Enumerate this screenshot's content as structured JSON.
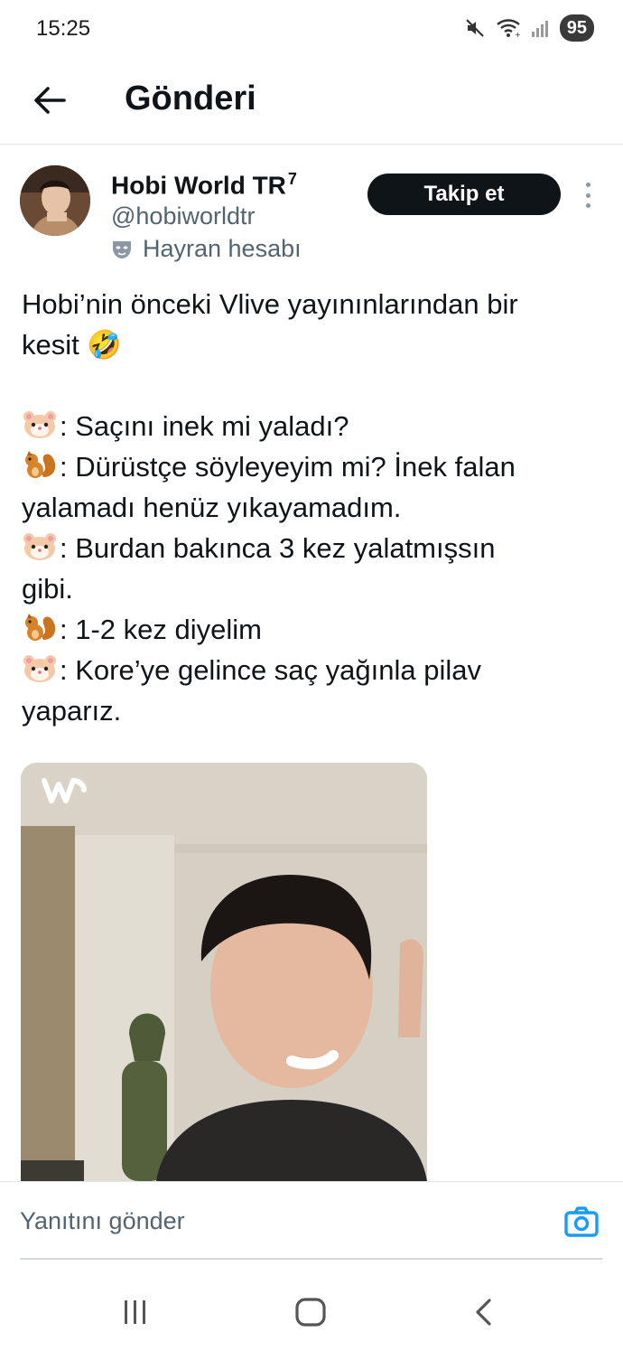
{
  "status_bar": {
    "time": "15:25",
    "battery": "95",
    "icons": [
      "mute-icon",
      "wifi-icon",
      "signal-icon",
      "battery-icon"
    ]
  },
  "app_bar": {
    "title": "Gönderi",
    "back_icon": "back-arrow-icon"
  },
  "post": {
    "author": {
      "name": "Hobi World TR",
      "name_suffix": "7",
      "handle": "@hobiworldtr",
      "badge_text": "Hayran hesabı",
      "badge_icon": "mask-icon"
    },
    "follow_label": "Takip et",
    "text_lines": [
      {
        "emoji": "",
        "text": "Hobi’nin önceki Vlive yayınınlarından bir"
      },
      {
        "emoji": "",
        "text": "kesit 🤣"
      }
    ],
    "dialogue": [
      {
        "speaker_icon": "hamster-icon",
        "text": ": Saçını inek mi yaladı?"
      },
      {
        "speaker_icon": "squirrel-icon",
        "text": ": Dürüstçe söyleyeyim mi? İnek falan"
      },
      {
        "speaker_icon": "",
        "text": "yalamadı henüz yıkayamadım."
      },
      {
        "speaker_icon": "hamster-icon",
        "text": ": Burdan bakınca 3 kez yalatmışsın"
      },
      {
        "speaker_icon": "",
        "text": "gibi."
      },
      {
        "speaker_icon": "squirrel-icon",
        "text": ": 1-2 kez diyelim"
      },
      {
        "speaker_icon": "hamster-icon",
        "text": ": Kore’ye gelince saç yağınla pilav"
      },
      {
        "speaker_icon": "",
        "text": "yaparız."
      }
    ],
    "media": {
      "logo_icon": "weverse-logo-icon"
    }
  },
  "reply": {
    "placeholder": "Yanıtını gönder",
    "camera_icon": "camera-icon"
  },
  "nav_bar": {
    "icons": [
      "recent-apps-icon",
      "home-icon",
      "back-icon"
    ]
  },
  "colors": {
    "accent": "#1d9bf0",
    "text_primary": "#0f1419",
    "text_secondary": "#536471",
    "follow_button": "#0f1419"
  }
}
